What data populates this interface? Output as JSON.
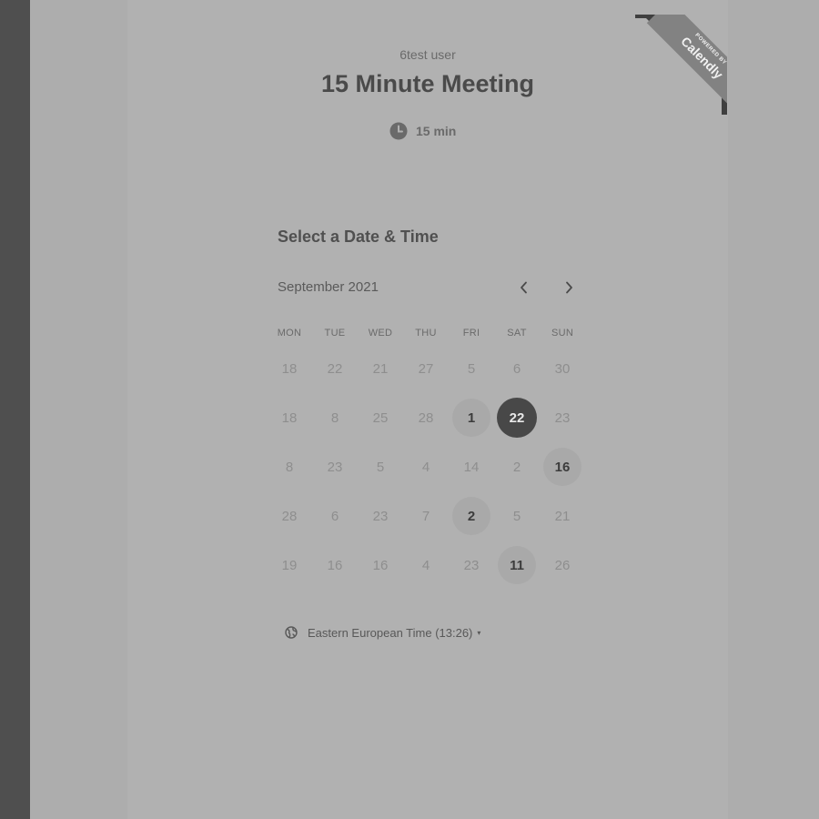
{
  "colors": {
    "background": "#adadad",
    "sidebar": "#4f4f4f",
    "selected_day": "#484848",
    "available_day": "#a9a9a9",
    "ribbon": "#828282"
  },
  "ribbon": {
    "powered_by": "POWERED BY",
    "brand": "Calendly"
  },
  "event": {
    "owner": "6test user",
    "title": "15 Minute Meeting",
    "duration": "15 min",
    "duration_icon": "clock-icon"
  },
  "scheduler": {
    "section_title": "Select a Date & Time",
    "month_label": "September 2021",
    "prev_icon": "chevron-left-icon",
    "next_icon": "chevron-right-icon",
    "weekdays": [
      "MON",
      "TUE",
      "WED",
      "THU",
      "FRI",
      "SAT",
      "SUN"
    ],
    "weeks": [
      [
        {
          "label": "18",
          "state": "disabled"
        },
        {
          "label": "22",
          "state": "disabled"
        },
        {
          "label": "21",
          "state": "disabled"
        },
        {
          "label": "27",
          "state": "disabled"
        },
        {
          "label": "5",
          "state": "disabled"
        },
        {
          "label": "6",
          "state": "disabled"
        },
        {
          "label": "30",
          "state": "disabled"
        }
      ],
      [
        {
          "label": "18",
          "state": "disabled"
        },
        {
          "label": "8",
          "state": "disabled"
        },
        {
          "label": "25",
          "state": "disabled"
        },
        {
          "label": "28",
          "state": "disabled"
        },
        {
          "label": "1",
          "state": "available"
        },
        {
          "label": "22",
          "state": "selected"
        },
        {
          "label": "23",
          "state": "disabled"
        }
      ],
      [
        {
          "label": "8",
          "state": "disabled"
        },
        {
          "label": "23",
          "state": "disabled"
        },
        {
          "label": "5",
          "state": "disabled"
        },
        {
          "label": "4",
          "state": "disabled"
        },
        {
          "label": "14",
          "state": "disabled"
        },
        {
          "label": "2",
          "state": "disabled"
        },
        {
          "label": "16",
          "state": "available"
        }
      ],
      [
        {
          "label": "28",
          "state": "disabled"
        },
        {
          "label": "6",
          "state": "disabled"
        },
        {
          "label": "23",
          "state": "disabled"
        },
        {
          "label": "7",
          "state": "disabled"
        },
        {
          "label": "2",
          "state": "available"
        },
        {
          "label": "5",
          "state": "disabled"
        },
        {
          "label": "21",
          "state": "disabled"
        }
      ],
      [
        {
          "label": "19",
          "state": "disabled"
        },
        {
          "label": "16",
          "state": "disabled"
        },
        {
          "label": "16",
          "state": "disabled"
        },
        {
          "label": "4",
          "state": "disabled"
        },
        {
          "label": "23",
          "state": "disabled"
        },
        {
          "label": "11",
          "state": "available"
        },
        {
          "label": "26",
          "state": "disabled"
        }
      ]
    ],
    "timezone": {
      "icon": "globe-icon",
      "label": "Eastern European Time (13:26)",
      "caret": "▾"
    }
  }
}
